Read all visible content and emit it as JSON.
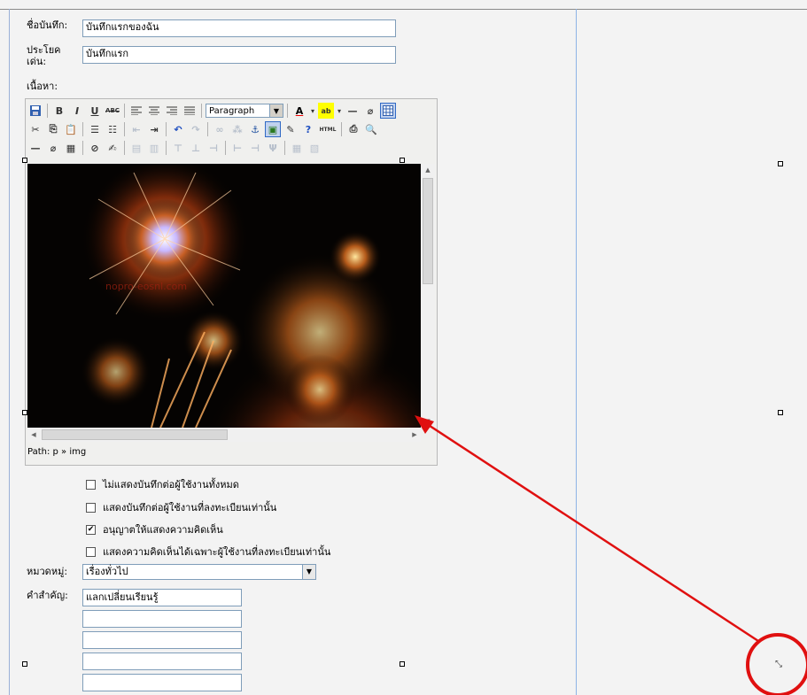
{
  "form": {
    "title_label": "ชื่อบันทึก:",
    "title_value": "บันทึกแรกของฉัน",
    "summary_label": "ประโยค\nเด่น:",
    "summary_value": "บันทึกแรก",
    "content_label": "เนื้อหา:"
  },
  "editor": {
    "format_select": "Paragraph",
    "path": "Path: p » img",
    "image_watermark": "nopro-eosnl.com",
    "image_description": "fireworks photo"
  },
  "options": [
    {
      "label": "ไม่แสดงบันทึกต่อผู้ใช้งานทั้งหมด",
      "checked": false
    },
    {
      "label": "แสดงบันทึกต่อผู้ใช้งานที่ลงทะเบียนเท่านั้น",
      "checked": false
    },
    {
      "label": "อนุญาตให้แสดงความคิดเห็น",
      "checked": true
    },
    {
      "label": "แสดงความคิดเห็นได้เฉพาะผู้ใช้งานที่ลงทะเบียนเท่านั้น",
      "checked": false
    }
  ],
  "category": {
    "label": "หมวดหมู่:",
    "value": "เรื่องทั่วไป"
  },
  "keywords": {
    "label": "คำสำคัญ:",
    "values": [
      "แลกเปลี่ยนเรียนรู้",
      "",
      "",
      "",
      ""
    ]
  },
  "colors": {
    "annotation": "#e01010",
    "divider": "#8db3e6"
  }
}
